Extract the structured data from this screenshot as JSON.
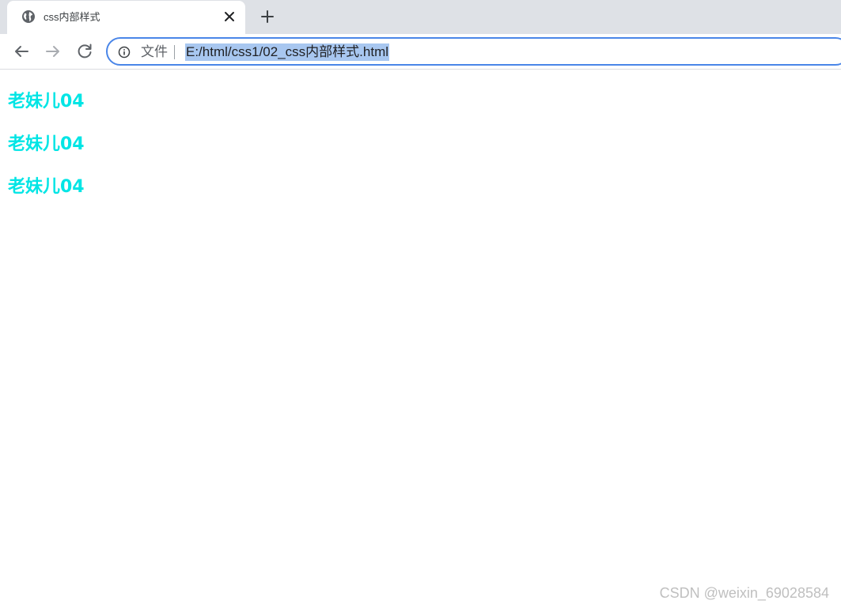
{
  "browser": {
    "tab": {
      "title": "css内部样式",
      "favicon_icon": "globe-icon",
      "close_icon": "close-icon"
    },
    "new_tab_icon": "plus-icon",
    "nav": {
      "back_icon": "arrow-left-icon",
      "forward_icon": "arrow-right-icon",
      "reload_icon": "reload-icon"
    },
    "omnibox": {
      "info_icon": "info-icon",
      "scheme_label": "文件",
      "url": "E:/html/css1/02_css内部样式.html",
      "url_selected": true,
      "focus_color": "#4a86e8",
      "selection_color": "#a8c7f0"
    }
  },
  "page": {
    "headings": [
      "老妹儿04",
      "老妹儿04",
      "老妹儿04"
    ],
    "heading_color": "#00e5e5"
  },
  "watermark": "CSDN @weixin_69028584"
}
